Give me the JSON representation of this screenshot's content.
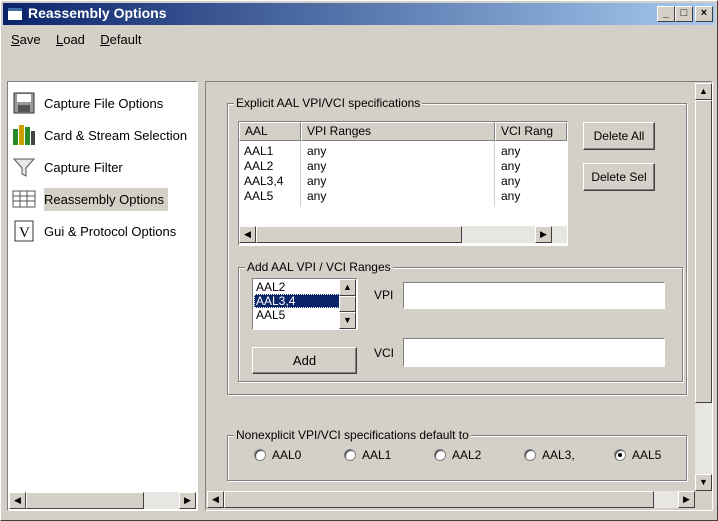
{
  "window": {
    "title": "Reassembly Options",
    "controls": [
      "_",
      "□",
      "×"
    ]
  },
  "menu": [
    {
      "label": "Save"
    },
    {
      "label": "Load"
    },
    {
      "label": "Default"
    }
  ],
  "nav": {
    "items": [
      {
        "label": "Capture File Options",
        "icon": "floppy-disk-icon",
        "selected": false
      },
      {
        "label": "Card & Stream Selection",
        "icon": "network-card-icon",
        "selected": false
      },
      {
        "label": "Capture Filter",
        "icon": "filter-funnel-icon",
        "selected": false
      },
      {
        "label": "Reassembly Options",
        "icon": "reassembly-grid-icon",
        "selected": true
      },
      {
        "label": "Gui & Protocol Options",
        "icon": "v-document-icon",
        "selected": false
      }
    ]
  },
  "explicit": {
    "group_title": "Explicit AAL VPI/VCI specifications",
    "columns": [
      "AAL",
      "VPI Ranges",
      "VCI Rang"
    ],
    "rows": [
      [
        "AAL1",
        "any",
        "any"
      ],
      [
        "AAL2",
        "any",
        "any"
      ],
      [
        "AAL3,4",
        "any",
        "any"
      ],
      [
        "AAL5",
        "any",
        "any"
      ]
    ],
    "delete_all_label": "Delete All",
    "delete_sel_label": "Delete Sel"
  },
  "add": {
    "group_title": "Add AAL VPI / VCI Ranges",
    "aal_options": [
      "AAL2",
      "AAL3,4",
      "AAL5"
    ],
    "aal_selected": "AAL3,4",
    "vpi_label": "VPI",
    "vpi_value": "",
    "vci_label": "VCI",
    "vci_value": "",
    "add_label": "Add"
  },
  "nonexplicit": {
    "group_title": "Nonexplicit VPI/VCI specifications default to",
    "options": [
      {
        "label": "AAL0",
        "checked": false
      },
      {
        "label": "AAL1",
        "checked": false
      },
      {
        "label": "AAL2",
        "checked": false
      },
      {
        "label": "AAL3,",
        "checked": false
      },
      {
        "label": "AAL5",
        "checked": true
      }
    ]
  }
}
